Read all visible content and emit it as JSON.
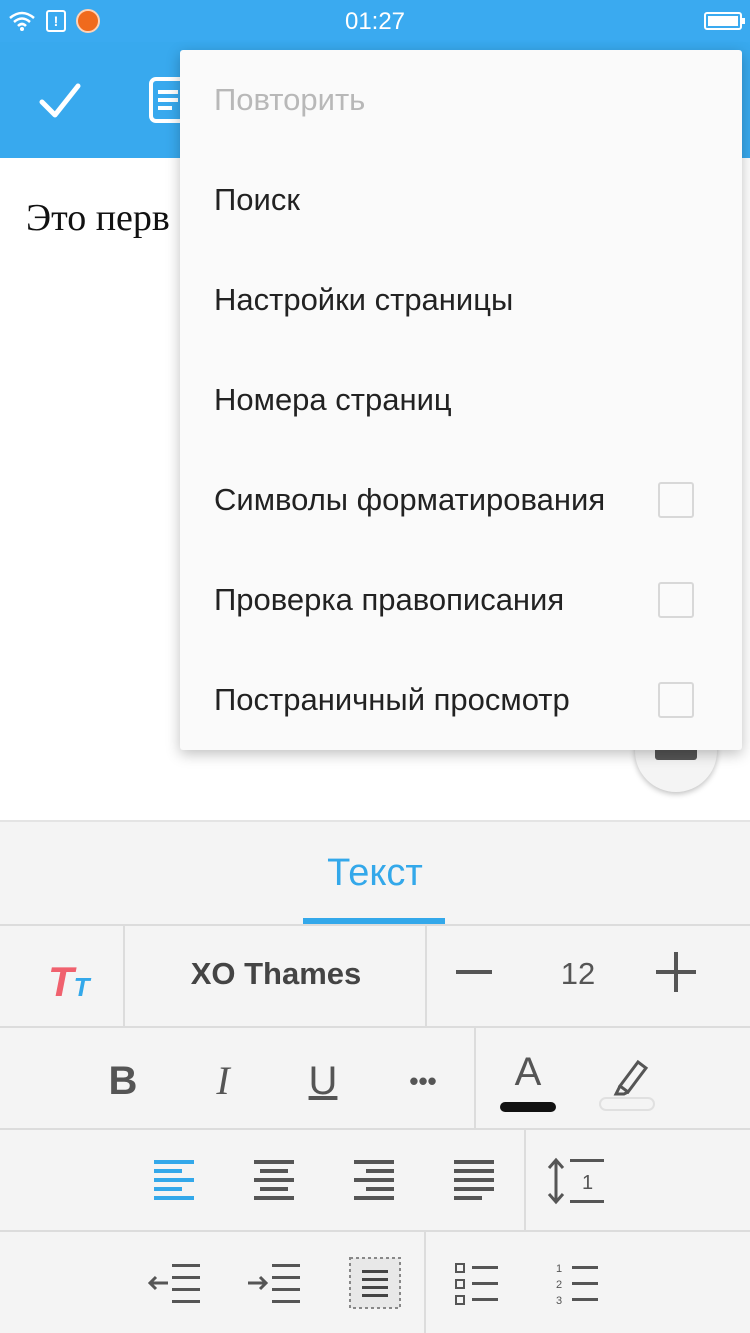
{
  "status_bar": {
    "time": "01:27",
    "icons": [
      "wifi-icon",
      "alert-icon",
      "app-notification-icon",
      "battery-icon"
    ]
  },
  "toolbar": {
    "icons": [
      "check-icon",
      "document-icon"
    ]
  },
  "document": {
    "text": "Это перв"
  },
  "menu": {
    "items": [
      {
        "label": "Повторить",
        "enabled": false
      },
      {
        "label": "Поиск",
        "enabled": true
      },
      {
        "label": "Настройки страницы",
        "enabled": true
      },
      {
        "label": "Номера страниц",
        "enabled": true
      },
      {
        "label": "Символы форматирования",
        "enabled": true,
        "checked": false
      },
      {
        "label": "Проверка правописания",
        "enabled": true,
        "checked": false
      },
      {
        "label": "Постраничный просмотр",
        "enabled": true,
        "checked": false
      }
    ]
  },
  "panel": {
    "tab_label": "Текст",
    "font_name": "XO Thames",
    "font_size": "12",
    "format_labels": {
      "bold": "B",
      "italic": "I",
      "underline": "U",
      "more": "•••",
      "color": "A"
    },
    "line_spacing_label": "1",
    "numbered_labels": [
      "1",
      "2",
      "3"
    ],
    "colors": {
      "accent": "#33a8ea",
      "font_style_primary": "#f0616e",
      "text_color_bar": "#111111"
    }
  }
}
